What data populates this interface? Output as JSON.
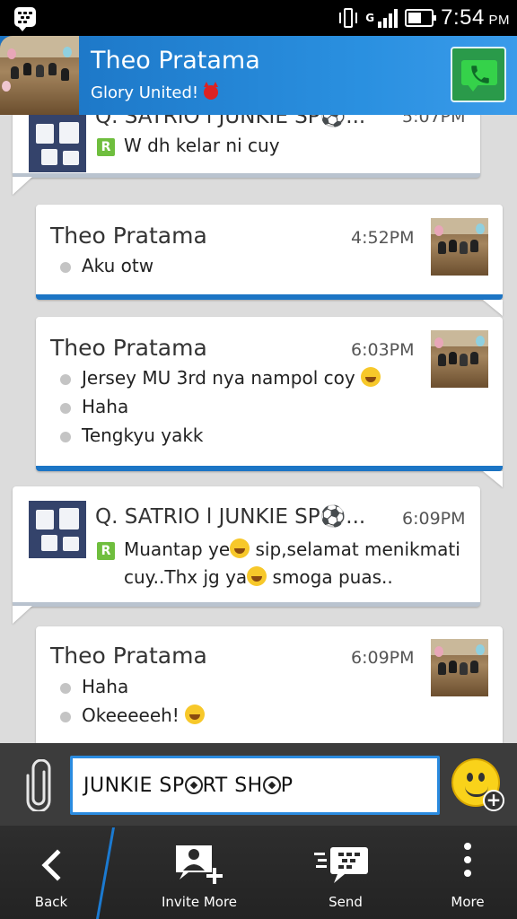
{
  "status_bar": {
    "time": "7:54",
    "time_suffix": "PM"
  },
  "header": {
    "contact_name": "Theo Pratama",
    "status": "Glory United!"
  },
  "messages": [
    {
      "direction": "in",
      "sender": "Q. SATRIO l JUNKIE SP⚽️...",
      "time": "5:07PM",
      "lines": [
        "W dh kelar ni cuy"
      ]
    },
    {
      "direction": "out",
      "sender": "Theo Pratama",
      "time": "4:52PM",
      "lines": [
        "Aku otw"
      ]
    },
    {
      "direction": "out",
      "sender": "Theo Pratama",
      "time": "6:03PM",
      "lines": [
        "Jersey MU 3rd nya nampol coy",
        "Haha",
        "Tengkyu yakk"
      ]
    },
    {
      "direction": "in",
      "sender": "Q. SATRIO l JUNKIE SP⚽️...",
      "time": "6:09PM",
      "lines": [
        "Muantap ye",
        "sip,selamat menikmati",
        "cuy..Thx jg ya",
        "smoga puas.."
      ]
    },
    {
      "direction": "out",
      "sender": "Theo Pratama",
      "time": "6:09PM",
      "lines": [
        "Haha",
        "Okeeeeeh!"
      ]
    }
  ],
  "compose": {
    "text_part1": "JUNKIE SP",
    "text_part2": "RT SH",
    "text_part3": "P"
  },
  "actions": [
    {
      "label": "Back",
      "icon": "chevron-left-icon"
    },
    {
      "label": "Invite More",
      "icon": "add-contact-icon"
    },
    {
      "label": "Send",
      "icon": "bbm-send-icon"
    },
    {
      "label": "More",
      "icon": "overflow-dots-icon"
    }
  ]
}
